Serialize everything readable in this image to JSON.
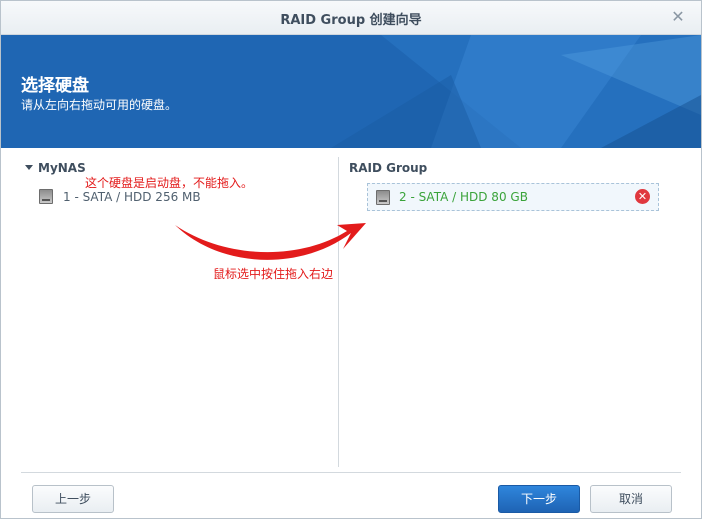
{
  "window": {
    "title": "RAID Group 创建向导"
  },
  "banner": {
    "title": "选择硬盘",
    "subtitle": "请从左向右拖动可用的硬盘。"
  },
  "left_pane": {
    "tree_root": "MyNAS",
    "disks": [
      {
        "label": "1 - SATA / HDD 256 MB"
      }
    ]
  },
  "right_pane": {
    "header": "RAID Group",
    "disks": [
      {
        "label": "2 - SATA / HDD 80 GB"
      }
    ]
  },
  "annotations": {
    "note_boot_disk": "这个硬盘是启动盘，不能拖入。",
    "note_drag": "鼠标选中按住拖入右边"
  },
  "buttons": {
    "back": "上一步",
    "next": "下一步",
    "cancel": "取消"
  },
  "colors": {
    "banner": "#1f66b3",
    "accent": "#1e63b4",
    "annotation": "#e31b1b",
    "selected_disk": "#3aa33a",
    "remove": "#e0383e"
  },
  "icons": {
    "close": "close-icon",
    "disk": "hdd-icon",
    "remove": "remove-icon",
    "caret": "caret-down-icon"
  }
}
